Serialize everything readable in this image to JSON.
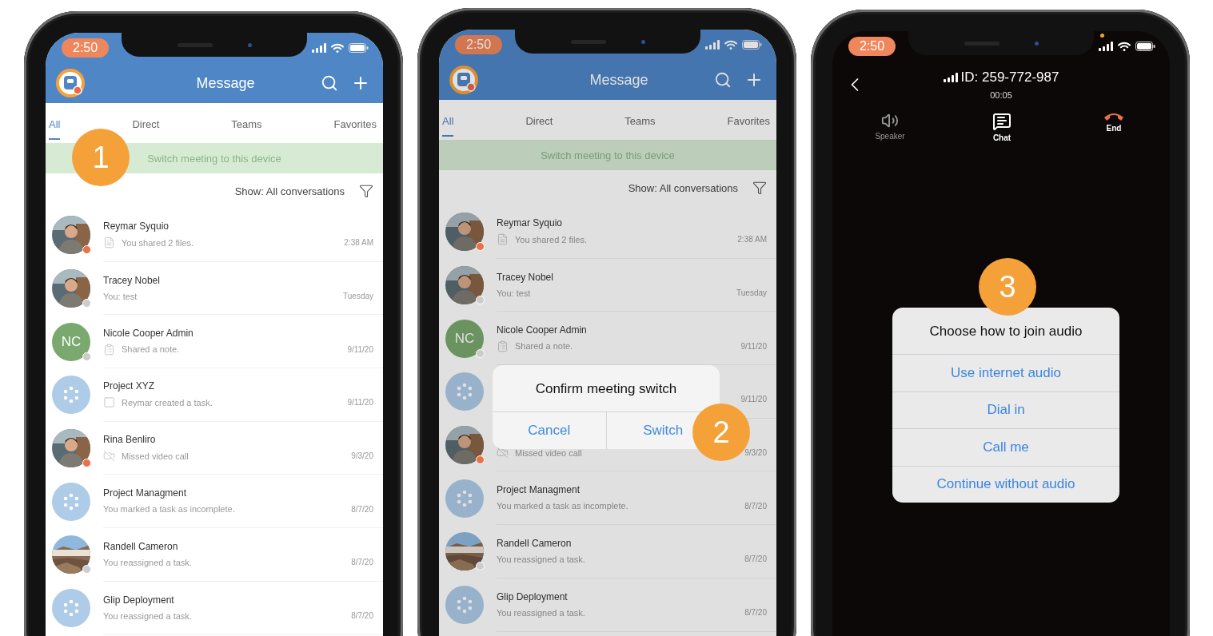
{
  "phones": [
    {
      "kind": "messages",
      "status": {
        "time": "2:50"
      },
      "header": {
        "title": "Message"
      },
      "tabs": [
        {
          "label": "All",
          "selected": true
        },
        {
          "label": "Direct",
          "selected": false
        },
        {
          "label": "Teams",
          "selected": false
        },
        {
          "label": "Favorites",
          "selected": false
        }
      ],
      "banner": "Switch meeting to this device",
      "filter": "Show: All conversations",
      "conversations": [
        {
          "name": "Reymar Syquio",
          "preview": "You shared 2 files.",
          "time": "2:38 AM",
          "avatar": {
            "kind": "portrait"
          },
          "color": "#e8704a",
          "attachment": {
            "kind": "file"
          }
        },
        {
          "name": "Tracey Nobel",
          "preview": "You: test",
          "time": "Tuesday",
          "avatar": {
            "kind": "portrait"
          },
          "color": "#cccccc"
        },
        {
          "name": "Nicole Cooper Admin",
          "preview": "Shared a note.",
          "time": "9/11/20",
          "avatar": {
            "kind": "initials",
            "initials": "NC"
          },
          "color": "#cccccc",
          "attachment": {
            "kind": "note"
          }
        },
        {
          "name": "Project XYZ",
          "preview": "Reymar created a task.",
          "time": "9/11/20",
          "avatar": {
            "kind": "group"
          },
          "attachment": {
            "kind": "task"
          }
        },
        {
          "name": "Rina Benliro",
          "preview": "Missed video call",
          "time": "9/3/20",
          "avatar": {
            "kind": "portrait"
          },
          "color": "#e8704a",
          "attachment": {
            "kind": "video"
          }
        },
        {
          "name": "Project Managment",
          "preview": "You marked a task as incomplete.",
          "time": "8/7/20",
          "avatar": {
            "kind": "group"
          }
        },
        {
          "name": "Randell Cameron",
          "preview": "You reassigned a task.",
          "time": "8/7/20",
          "avatar": {
            "kind": "landscape"
          },
          "color": "#cccccc"
        },
        {
          "name": "Glip Deployment",
          "preview": "You reassigned a task.",
          "time": "8/7/20",
          "avatar": {
            "kind": "group"
          }
        }
      ],
      "step": "1"
    },
    {
      "kind": "messages",
      "status": {
        "time": "2:50"
      },
      "header": {
        "title": "Message"
      },
      "tabs": [
        {
          "label": "All",
          "selected": true
        },
        {
          "label": "Direct",
          "selected": false
        },
        {
          "label": "Teams",
          "selected": false
        },
        {
          "label": "Favorites",
          "selected": false
        }
      ],
      "banner": "Switch meeting to this device",
      "filter": "Show: All conversations",
      "dimmed": true,
      "conversations": [
        {
          "name": "Reymar Syquio",
          "preview": "You shared 2 files.",
          "time": "2:38 AM",
          "avatar": {
            "kind": "portrait"
          },
          "color": "#e8704a",
          "attachment": {
            "kind": "file"
          }
        },
        {
          "name": "Tracey Nobel",
          "preview": "You: test",
          "time": "Tuesday",
          "avatar": {
            "kind": "portrait"
          },
          "color": "#cccccc"
        },
        {
          "name": "Nicole Cooper Admin",
          "preview": "Shared a note.",
          "time": "9/11/20",
          "avatar": {
            "kind": "initials",
            "initials": "NC"
          },
          "color": "#cccccc",
          "attachment": {
            "kind": "note"
          }
        },
        {
          "time": "9/11/20",
          "avatar": {
            "kind": "group"
          }
        },
        {
          "preview": "Missed video call",
          "time": "9/3/20",
          "avatar": {
            "kind": "portrait"
          },
          "color": "#e8704a",
          "attachment": {
            "kind": "video"
          }
        },
        {
          "name": "Project Managment",
          "preview": "You marked a task as incomplete.",
          "time": "8/7/20",
          "avatar": {
            "kind": "group"
          }
        },
        {
          "name": "Randell Cameron",
          "preview": "You reassigned a task.",
          "time": "8/7/20",
          "avatar": {
            "kind": "landscape"
          },
          "color": "#cccccc"
        },
        {
          "name": "Glip Deployment",
          "preview": "You reassigned a task.",
          "time": "8/7/20",
          "avatar": {
            "kind": "group"
          }
        }
      ],
      "dialog": {
        "title": "Confirm meeting switch",
        "buttons": [
          "Cancel",
          "Switch"
        ]
      },
      "step": "2"
    },
    {
      "kind": "call",
      "status": {
        "time": "2:50",
        "mic_indicator": true
      },
      "call": {
        "id": "ID: 259-772-987",
        "timer": "00:05"
      },
      "controls": [
        {
          "label": "Speaker",
          "kind": "speaker",
          "active": false
        },
        {
          "label": "Chat",
          "kind": "chat",
          "active": true
        },
        {
          "label": "End",
          "kind": "end",
          "active": true
        }
      ],
      "dialog": {
        "title": "Choose how to join audio",
        "options": [
          "Use internet audio",
          "Dial in",
          "Call me",
          "Continue without audio"
        ]
      },
      "step": "3"
    }
  ]
}
